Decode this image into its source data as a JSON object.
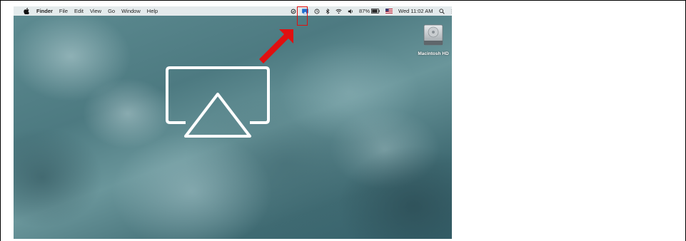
{
  "menubar": {
    "apple_icon": "apple-logo-icon",
    "app_name": "Finder",
    "menus": [
      "File",
      "Edit",
      "View",
      "Go",
      "Window",
      "Help"
    ],
    "status": {
      "battery_percent": "87%",
      "clock": "Wed 11:02 AM"
    }
  },
  "desktop": {
    "drive_label": "Macintosh HD"
  },
  "colors": {
    "highlight": "#e01010",
    "wallpaper_base": "#4d7a81"
  }
}
